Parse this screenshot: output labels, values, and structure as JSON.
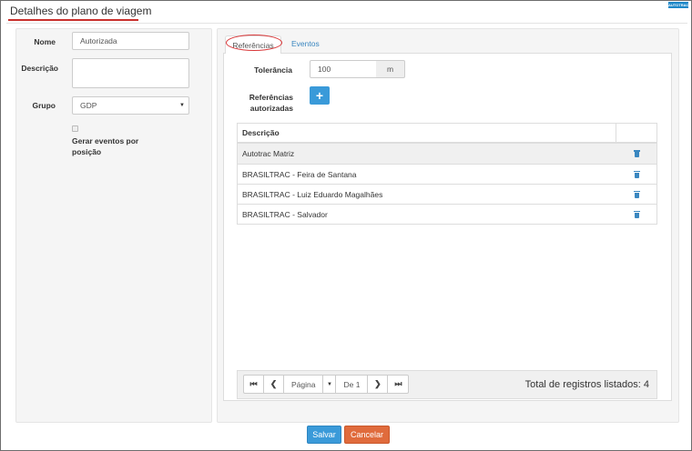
{
  "window": {
    "title": "Detalhes do plano de viagem",
    "brand": "AUTOTRAC"
  },
  "form": {
    "nome_label": "Nome",
    "nome_value": "Autorizada",
    "descricao_label": "Descrição",
    "descricao_value": "",
    "grupo_label": "Grupo",
    "grupo_value": "GDP",
    "gerar_eventos_label_line1": "Gerar eventos por",
    "gerar_eventos_label_line2": "posição",
    "gerar_eventos_checked": false
  },
  "tabs": [
    {
      "label": "Referências",
      "active": true
    },
    {
      "label": "Eventos",
      "active": false
    }
  ],
  "referencias": {
    "tolerancia_label": "Tolerância",
    "tolerancia_value": "100",
    "tolerancia_unit": "m",
    "autorizadas_label_line1": "Referências",
    "autorizadas_label_line2": "autorizadas",
    "add_button_icon": "plus-icon",
    "table": {
      "column_header": "Descrição",
      "rows": [
        {
          "descricao": "Autotrac Matriz"
        },
        {
          "descricao": "BRASILTRAC - Feira de Santana"
        },
        {
          "descricao": "BRASILTRAC - Luiz Eduardo Magalhães"
        },
        {
          "descricao": "BRASILTRAC - Salvador"
        }
      ]
    },
    "pager": {
      "page_label": "Página",
      "of_label": "De 1",
      "total_text": "Total de registros listados: 4"
    }
  },
  "actions": {
    "save_label": "Salvar",
    "cancel_label": "Cancelar"
  },
  "colors": {
    "accent_red": "#c9302c",
    "primary_blue": "#3a9ad9",
    "cancel_orange": "#e06b3c",
    "link_blue": "#3a87c0"
  }
}
